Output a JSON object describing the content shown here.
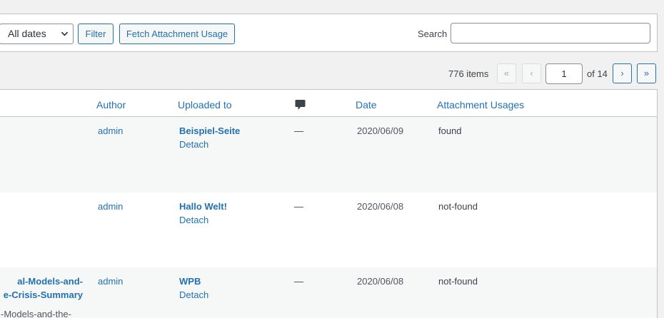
{
  "filters": {
    "date_select": "All dates",
    "filter_label": "Filter",
    "fetch_label": "Fetch Attachment Usage",
    "search_label": "Search",
    "search_value": ""
  },
  "pagination": {
    "items_count": "776 items",
    "first": "«",
    "prev": "‹",
    "current_page": "1",
    "of_total": "of 14",
    "next": "›",
    "last": "»"
  },
  "table": {
    "headers": {
      "author": "Author",
      "uploaded_to": "Uploaded to",
      "comments_icon": "comment-icon",
      "date": "Date",
      "usages": "Attachment Usages"
    },
    "rows": [
      {
        "author": "admin",
        "uploaded_to": "Beispiel-Seite",
        "detach": "Detach",
        "comments": "—",
        "date": "2020/06/09",
        "usage": "found"
      },
      {
        "author": "admin",
        "uploaded_to": "Hallo Welt!",
        "detach": "Detach",
        "comments": "—",
        "date": "2020/06/08",
        "usage": "not-found"
      },
      {
        "title_line1": "al-Models-and-",
        "title_line2": "e-Crisis-Summary",
        "filename": "-Models-and-the-",
        "author": "admin",
        "uploaded_to": "WPB",
        "detach": "Detach",
        "comments": "—",
        "date": "2020/06/08",
        "usage": "not-found"
      }
    ]
  },
  "colors": {
    "link": "#2271b1",
    "background": "#f1f1f1",
    "border": "#c3c4c7"
  }
}
